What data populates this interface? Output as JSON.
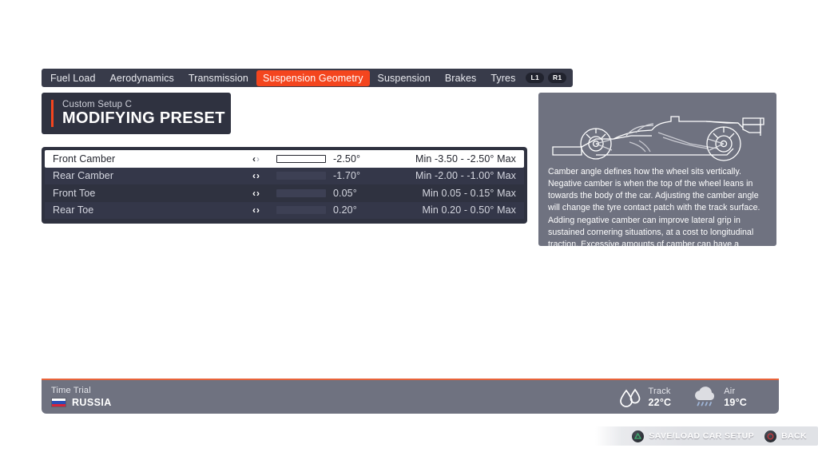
{
  "tabs": [
    {
      "label": "Fuel Load",
      "active": false
    },
    {
      "label": "Aerodynamics",
      "active": false
    },
    {
      "label": "Transmission",
      "active": false
    },
    {
      "label": "Suspension Geometry",
      "active": true
    },
    {
      "label": "Suspension",
      "active": false
    },
    {
      "label": "Brakes",
      "active": false
    },
    {
      "label": "Tyres",
      "active": false
    }
  ],
  "bumpers": {
    "left": "L1",
    "right": "R1"
  },
  "preset": {
    "subtitle": "Custom Setup  C",
    "title": "MODIFYING PRESET"
  },
  "settings": [
    {
      "label": "Front Camber",
      "value": "-2.50°",
      "range": "Min -3.50 - -2.50° Max",
      "fill_percent": 0,
      "selected": true,
      "left_arrow": "‹",
      "right_arrow": "›",
      "right_arrow_disabled": true
    },
    {
      "label": "Rear Camber",
      "value": "-1.70°",
      "range": "Min -2.00 - -1.00° Max",
      "fill_percent": 33,
      "selected": false,
      "left_arrow": "‹",
      "right_arrow": "›",
      "right_arrow_disabled": false
    },
    {
      "label": "Front Toe",
      "value": "0.05°",
      "range": "Min 0.05 - 0.15° Max",
      "fill_percent": 0,
      "selected": false,
      "left_arrow": "‹",
      "right_arrow": "›",
      "right_arrow_disabled": false
    },
    {
      "label": "Rear Toe",
      "value": "0.20°",
      "range": "Min 0.20 - 0.50° Max",
      "fill_percent": 0,
      "selected": false,
      "left_arrow": "‹",
      "right_arrow": "›",
      "right_arrow_disabled": false
    }
  ],
  "info": {
    "car_icon": "f1-car-side-profile-icon",
    "description": "Camber angle defines how the wheel sits vertically. Negative camber is when the top of the wheel leans in towards the body of the car. Adjusting the camber angle will change the tyre contact patch with the track surface. Adding negative camber can improve lateral grip in sustained cornering situations, at a cost to longitudinal traction. Excessive amounts of camber can have a negative effect on tyre wear."
  },
  "footer": {
    "mode": "Time Trial",
    "country": "RUSSIA",
    "flag_icon": "russia-flag-icon",
    "weather": [
      {
        "icon": "water-drops-icon",
        "label": "Track",
        "value": "22°C"
      },
      {
        "icon": "rain-cloud-icon",
        "label": "Air",
        "value": "19°C"
      }
    ]
  },
  "prompts": [
    {
      "button": "triangle",
      "label": "SAVE/LOAD CAR SETUP"
    },
    {
      "button": "circle",
      "label": "BACK"
    }
  ],
  "colors": {
    "accent": "#f4451e",
    "panel_dark": "#2f3240",
    "panel_grey": "#6f7280",
    "footer_accent": "#e8633a",
    "triangle_green": "#3fae6e",
    "circle_red": "#c8383c"
  }
}
